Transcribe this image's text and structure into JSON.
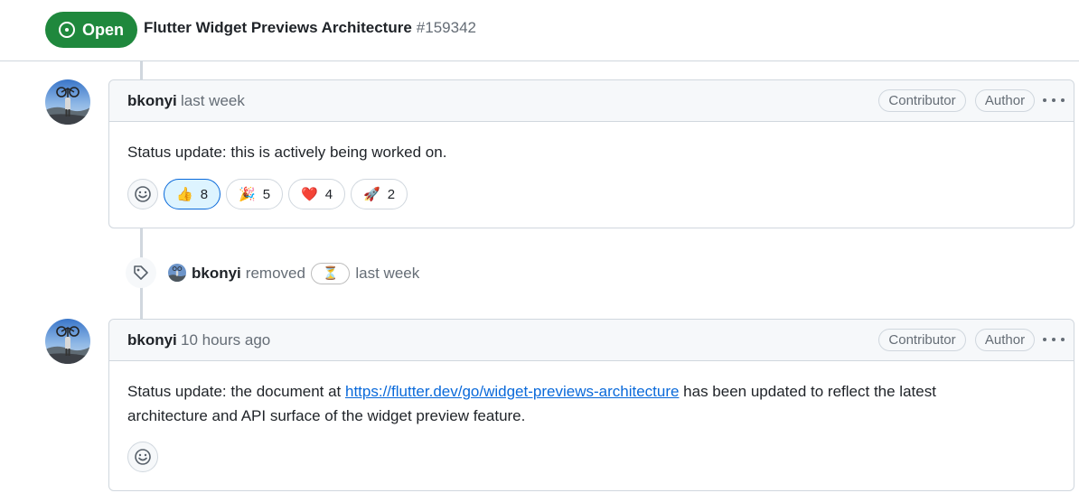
{
  "issue": {
    "state_label": "Open",
    "title": "Flutter Widget Previews Architecture",
    "number": "#159342"
  },
  "comments": [
    {
      "author": "bkonyi",
      "time": "last week",
      "badges": [
        "Contributor",
        "Author"
      ],
      "body": "Status update: this is actively being worked on.",
      "reactions": [
        {
          "emoji": "👍",
          "count": "8",
          "active": true
        },
        {
          "emoji": "🎉",
          "count": "5",
          "active": false
        },
        {
          "emoji": "❤️",
          "count": "4",
          "active": false
        },
        {
          "emoji": "🚀",
          "count": "2",
          "active": false
        }
      ]
    },
    {
      "author": "bkonyi",
      "time": "10 hours ago",
      "badges": [
        "Contributor",
        "Author"
      ],
      "body_prefix": "Status update: the document at ",
      "link_text": "https://flutter.dev/go/widget-previews-architecture",
      "body_suffix": " has been updated to reflect the latest architecture and API surface of the widget preview feature."
    }
  ],
  "event": {
    "actor": "bkonyi",
    "action": "removed",
    "label": "⏳",
    "time": "last week"
  },
  "colors": {
    "open_green": "#1f883d",
    "link_blue": "#0969da",
    "active_reaction_bg": "#ddf4ff",
    "border": "#d0d7de"
  },
  "icons": [
    "issue-opened-icon",
    "tag-icon",
    "smiley-icon",
    "kebab-horizontal-icon"
  ]
}
